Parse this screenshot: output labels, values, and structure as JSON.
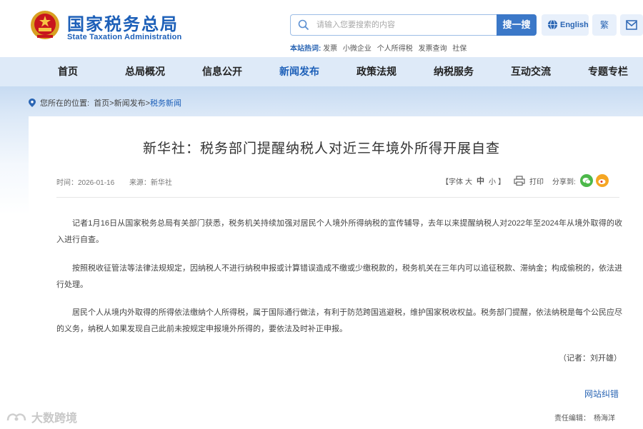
{
  "header": {
    "logo_cn": "国家税务总局",
    "logo_en": "State Taxation Administration",
    "search_placeholder": "请输入您要搜索的内容",
    "search_button": "搜一搜",
    "english_label": "English",
    "traditional_label": "繁",
    "hot_label": "本站热词:",
    "hot_words": [
      "发票",
      "小微企业",
      "个人所得税",
      "发票查询",
      "社保"
    ]
  },
  "nav": {
    "items": [
      "首页",
      "总局概况",
      "信息公开",
      "新闻发布",
      "政策法规",
      "纳税服务",
      "互动交流",
      "专题专栏"
    ],
    "active_index": 3
  },
  "breadcrumb": {
    "prefix": "您所在的位置:",
    "path": "首页>新闻发布>",
    "current": "税务新闻"
  },
  "article": {
    "title": "新华社：税务部门提醒纳税人对近三年境外所得开展自查",
    "time": "时间：2026-01-16",
    "source": "来源：新华社",
    "font_bracket_open": "【字体",
    "font_big": "大",
    "font_mid": "中",
    "font_small": "小",
    "font_bracket_close": "】",
    "print_label": "打印",
    "share_label": "分享到:",
    "paragraphs": [
      "记者1月16日从国家税务总局有关部门获悉，税务机关持续加强对居民个人境外所得纳税的宣传辅导，去年以来提醒纳税人对2022年至2024年从境外取得的收入进行自查。",
      "按照税收征管法等法律法规规定，因纳税人不进行纳税申报或计算错误造成不缴或少缴税款的，税务机关在三年内可以追征税款、滞纳金；构成偷税的，依法进行处理。",
      "居民个人从境内外取得的所得依法缴纳个人所得税，属于国际通行做法，有利于防范跨国逃避税，维护国家税收权益。税务部门提醒，依法纳税是每个公民应尽的义务，纳税人如果发现自己此前未按规定申报境外所得的，要依法及时补正申报。"
    ],
    "reporter": "（记者：刘开雄）",
    "correction_link": "网站纠错",
    "editor": "责任编辑：　杨海洋"
  },
  "watermark": "大数跨境",
  "colors": {
    "brand_blue": "#1c5fb8",
    "button_blue": "#3b78c8",
    "nav_bg": "#deeaf8"
  }
}
